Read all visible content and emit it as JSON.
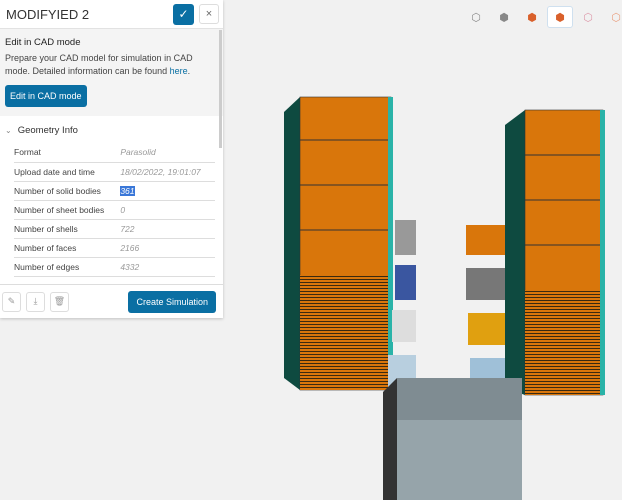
{
  "header": {
    "title": "MODIFYIED 2",
    "confirm": "✓",
    "close": "×"
  },
  "cad": {
    "title": "Edit in CAD mode",
    "text": "Prepare your CAD model for simulation in CAD mode. Detailed information can be found ",
    "link": "here",
    "period": ".",
    "button": "Edit in CAD mode"
  },
  "geometry": {
    "title": "Geometry Info",
    "rows": [
      {
        "label": "Format",
        "value": "Parasolid"
      },
      {
        "label": "Upload date and time",
        "value": "18/02/2022, 19:01:07"
      },
      {
        "label": "Number of solid bodies",
        "value": "361"
      },
      {
        "label": "Number of sheet bodies",
        "value": "0"
      },
      {
        "label": "Number of shells",
        "value": "722"
      },
      {
        "label": "Number of faces",
        "value": "2166"
      },
      {
        "label": "Number of edges",
        "value": "4332"
      }
    ]
  },
  "footer": {
    "create": "Create Simulation"
  },
  "colors": {
    "accent": "#0a6fa3",
    "orange": "#d9760b",
    "teal": "#0e4a40"
  }
}
